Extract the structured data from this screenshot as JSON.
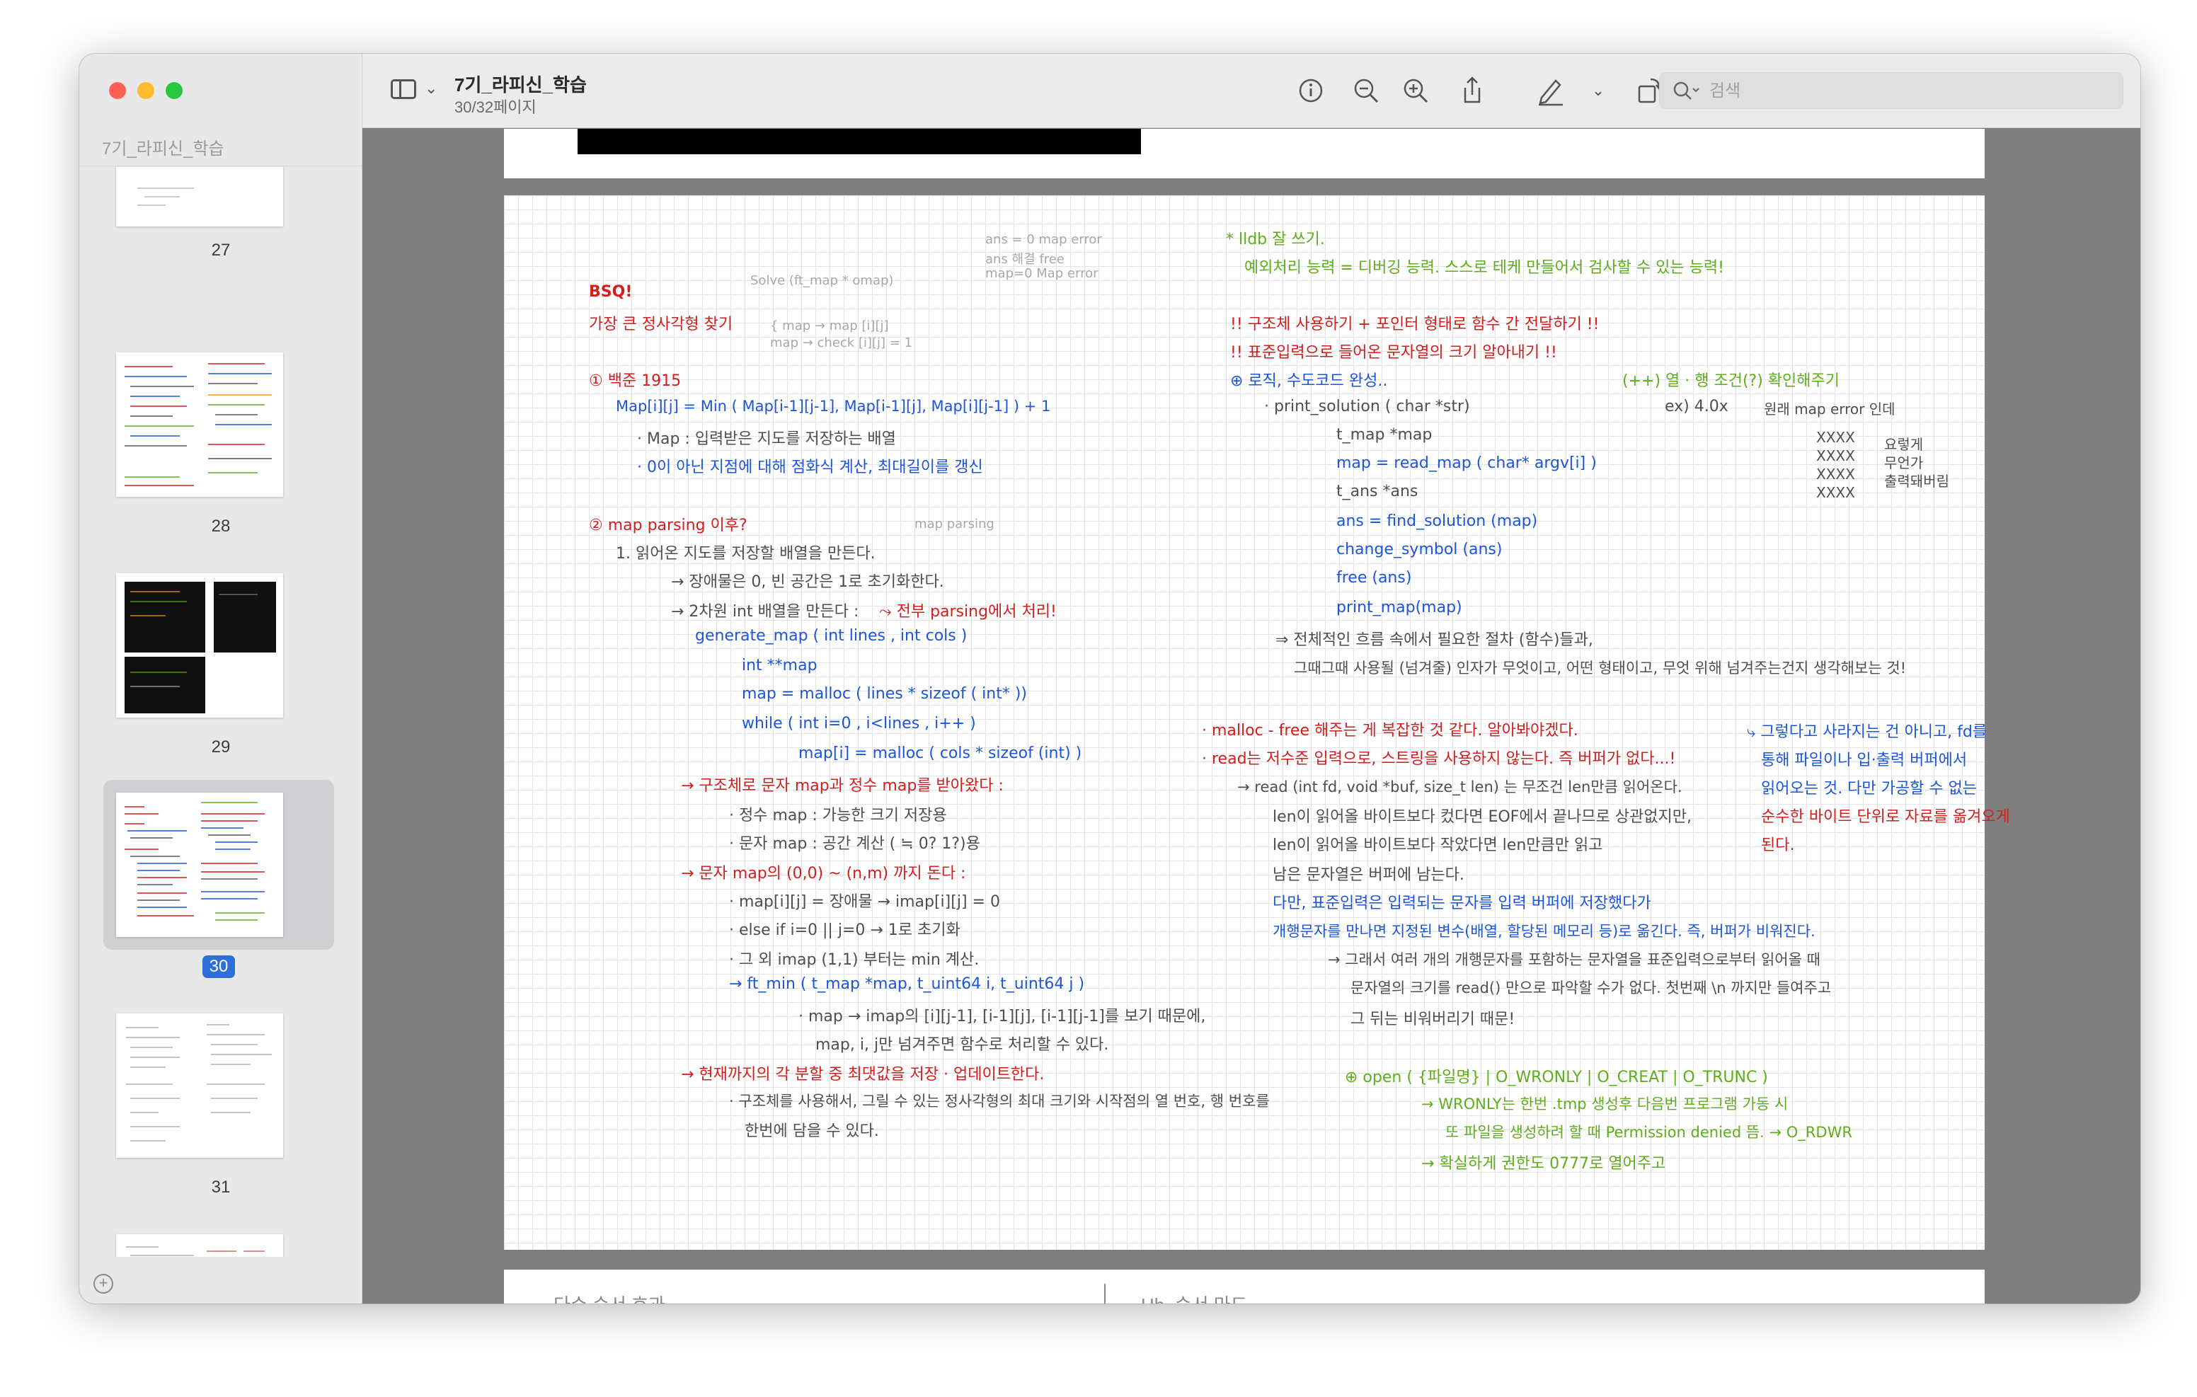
{
  "window": {
    "title": "7기_라피신_학습",
    "page_indicator": "30/32페이지"
  },
  "sidebar": {
    "title": "7기_라피신_학습",
    "thumbnails": [
      {
        "label": "27"
      },
      {
        "label": "28"
      },
      {
        "label": "29"
      },
      {
        "label": "30",
        "selected": true
      },
      {
        "label": "31"
      },
      {
        "label": ""
      }
    ]
  },
  "toolbar": {
    "search_placeholder": "검색",
    "icons": [
      "info-icon",
      "zoom-out-icon",
      "zoom-in-icon",
      "share-icon",
      "markup-pen-icon",
      "chevron-down-icon",
      "rotate-icon",
      "annotate-icon"
    ]
  },
  "next_page": {
    "left_text": "다수 순서 효과",
    "right_text": "Hb, 순서 마드,"
  },
  "notes": {
    "sketch": [
      "ans = 0   map error",
      "ans 해결    free",
      "map=0   Map error",
      "Solve (ft_map * omap)",
      "{ map → map [i][j]",
      "map → check [i][j] = 1",
      "map parsing"
    ],
    "left": [
      "BSQ!",
      "가장 큰 정사각형 찾기",
      "① 백준 1915",
      "Map[i][j] = Min ( Map[i-1][j-1], Map[i-1][j], Map[i][j-1] ) + 1",
      "· Map : 입력받은 지도를 저장하는 배열",
      "· 0이 아닌 지점에 대해 점화식 계산, 최대길이를 갱신",
      "② map parsing 이후?",
      "1. 읽어온 지도를 저장할 배열을 만든다.",
      "→ 장애물은 0, 빈 공간은 1로 초기화한다.",
      "→ 2차원 int 배열을 만든다 :",
      "⤳ 전부 parsing에서 처리!",
      "generate_map ( int lines , int cols )",
      "int **map",
      "map = malloc ( lines * sizeof ( int* ))",
      "while ( int i=0 , i<lines , i++ )",
      "map[i] = malloc ( cols * sizeof (int) )",
      "→ 구조체로 문자 map과 정수 map를 받아왔다 :",
      "· 정수 map : 가능한 크기 저장용",
      "· 문자 map : 공간 계산 ( ≒ 0? 1?)용",
      "→ 문자 map의 (0,0) ~ (n,m) 까지 돈다 :",
      "· map[i][j] = 장애물 → imap[i][j] = 0",
      "· else if i=0 || j=0 → 1로 초기화",
      "· 그 외 imap (1,1) 부터는 min 계산.",
      "→ ft_min ( t_map *map, t_uint64 i, t_uint64 j )",
      "· map → imap의 [i][j-1], [i-1][j], [i-1][j-1]를 보기 때문에,",
      "map, i, j만 넘겨주면 함수로 처리할 수 있다.",
      "→ 현재까지의 각 분할 중 최댓값을 저장 · 업데이트한다.",
      "· 구조체를 사용해서, 그릴 수 있는 정사각형의 최대 크기와 시작점의 열 번호, 행 번호를",
      "한번에 담을 수 있다."
    ],
    "right": [
      "* lldb 잘 쓰기.",
      "예외처리 능력 = 디버깅 능력. 스스로 테케 만들어서 검사할 수 있는 능력!",
      "!! 구조체 사용하기 + 포인터 형태로 함수 간 전달하기 !!",
      "!! 표준입력으로 들어온 문자열의 크기 알아내기 !!",
      "⊕ 로직, 수도코드 완성..",
      "(++) 열 · 행 조건(?) 확인해주기",
      "· print_solution ( char *str)",
      "ex) 4.0x",
      "t_map   *map",
      "map = read_map ( char* argv[i] )",
      "t_ans  *ans",
      "ans = find_solution (map)",
      "change_symbol (ans)",
      "free (ans)",
      "print_map(map)",
      "⇒ 전체적인 흐름 속에서 필요한 절차 (함수)들과,",
      "그때그때 사용될 (넘겨줄) 인자가 무엇이고, 어떤 형태이고, 무엇 위해 넘겨주는건지 생각해보는 것!",
      "원래 map error 인데",
      "XXXX",
      "XXXX",
      "XXXX",
      "XXXX",
      "요렇게",
      "무언가",
      "출력돼버림",
      "· malloc - free 해주는 게 복잡한 것 같다. 알아봐야겠다.",
      "· read는 저수준 입력으로, 스트링을 사용하지 않는다. 즉 버퍼가 없다...!",
      "→ read (int fd, void *buf, size_t len) 는 무조건 len만큼 읽어온다.",
      "len이 읽어올 바이트보다 컸다면 EOF에서 끝나므로 상관없지만,",
      "len이 읽어올 바이트보다 작았다면 len만큼만 읽고",
      "남은 문자열은 버퍼에 남는다.",
      "다만, 표준입력은 입력되는 문자를 입력 버퍼에 저장했다가",
      "개행문자를 만나면 지정된 변수(배열, 할당된 메모리 등)로 옮긴다. 즉, 버퍼가 비워진다.",
      "→ 그래서 여러 개의 개행문자를 포함하는 문자열을 표준입력으로부터 읽어올 때",
      "문자열의 크기를 read() 만으로 파악할 수가 없다. 첫번째 \\n 까지만 들여주고",
      "그 뒤는 비워버리기 때문!",
      "⤷ 그렇다고 사라지는 건 아니고, fd를",
      "통해 파일이나 입·출력 버퍼에서",
      "읽어오는 것. 다만 가공할 수 없는",
      "순수한 바이트 단위로 자료를 옮겨오게",
      "된다.",
      "⊕  open ( {파일명} | O_WRONLY | O_CREAT | O_TRUNC )",
      "→ WRONLY는 한번 .tmp 생성후 다음번 프로그램 가동 시",
      "또 파일을 생성하려 할 때 Permission denied 뜸. → O_RDWR",
      "→ 확실하게 권한도 0777로 열어주고"
    ]
  }
}
